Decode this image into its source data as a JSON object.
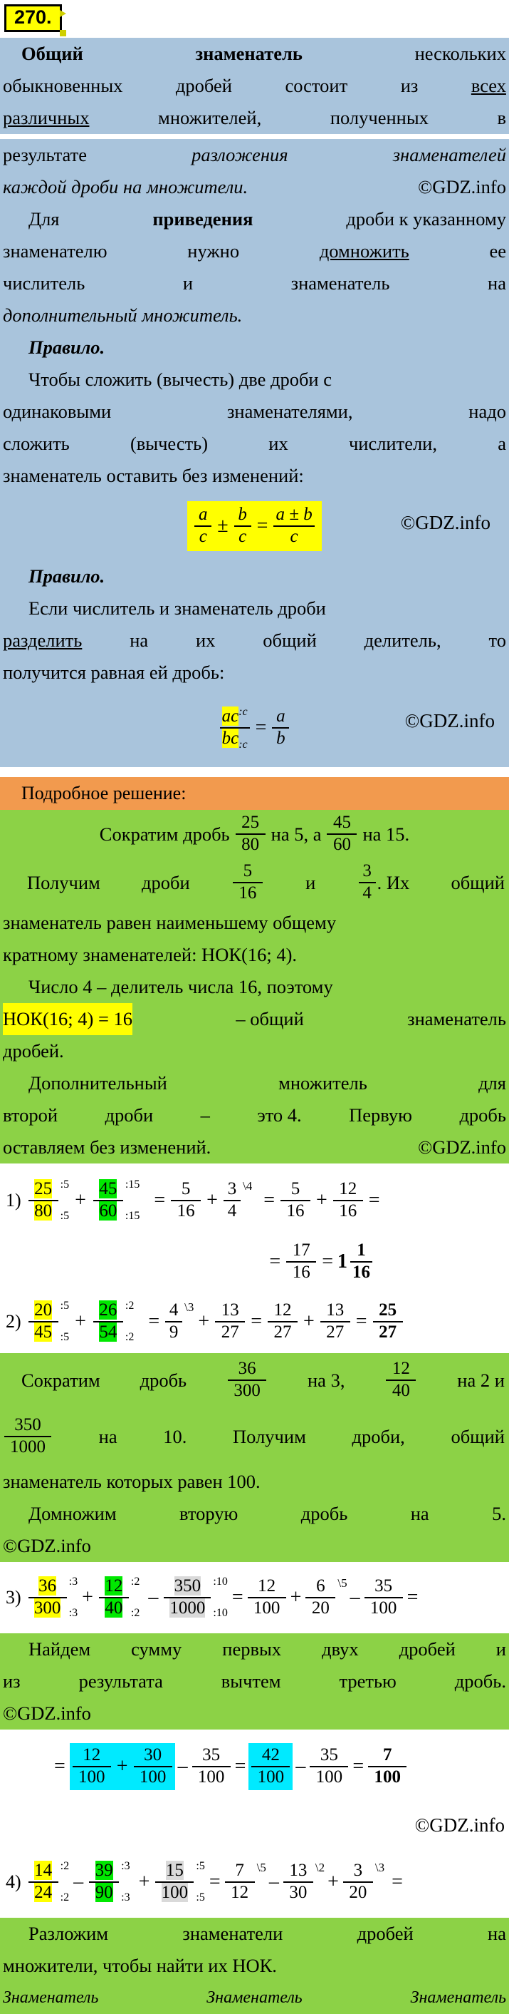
{
  "exercise": {
    "number": "270."
  },
  "watermark": {
    "small": "GDZ.INFO",
    "big": "GDZ.INFO",
    "copyright": "©GDZ.info"
  },
  "colors": {
    "theory_band": "#a9c4dc",
    "solution_band": "#8cd246",
    "header_band": "#f29a4e",
    "highlight_yellow": "#ffff00",
    "highlight_green": "#00e800",
    "highlight_cyan": "#00eaff",
    "highlight_gray": "#d9d9d9",
    "tag_yellow": "#ffff00"
  },
  "theory": {
    "p1": {
      "l1a": "Общий",
      "l1b": "знаменатель",
      "l1c": "нескольких",
      "l2a": "обыкновенных",
      "l2b": "дробей",
      "l2c": "состоит",
      "l2d": "из",
      "l2e": "всех",
      "l3a": "различных",
      "l3b": "множителей,",
      "l3c": "полученных",
      "l3d": "в",
      "l4a": "результате",
      "l4b": "разложения",
      "l4c": "знаменателей",
      "l5a": "каждой дроби на множители.",
      "l5b": "©GDZ.info"
    },
    "p2": {
      "l1a": "Для",
      "l1b": "приведения",
      "l1c": "дроби к указанному",
      "l2a": "знаменателю",
      "l2b": "нужно",
      "l2c": "домножить",
      "l2d": "ее",
      "l3a": "числитель",
      "l3b": "и",
      "l3c": "знаменатель",
      "l3d": "на",
      "l4": "дополнительный множитель."
    },
    "rule1": {
      "title": "Правило.",
      "l1a": "Чтобы сложить (вычесть) две дроби с",
      "l2a": "одинаковыми",
      "l2b": "знаменателями,",
      "l2c": "надо",
      "l3a": "сложить",
      "l3b": "(вычесть)",
      "l3c": "их",
      "l3d": "числители,",
      "l3e": "а",
      "l4": "знаменатель оставить без изменений:",
      "formula": {
        "n1": "a",
        "d1": "c",
        "op1": "±",
        "n2": "b",
        "d2": "c",
        "eq": "=",
        "n3": "a ± b",
        "d3": "c"
      },
      "gdz": "©GDZ.info"
    },
    "rule2": {
      "title": "Правило.",
      "l1": "Если числитель и знаменатель дроби",
      "l2a": "разделить",
      "l2b": "на",
      "l2c": "их",
      "l2d": "общий",
      "l2e": "делитель,",
      "l2f": "то",
      "l3": "получится равная ей дробь:",
      "formula": {
        "n1": "ac",
        "nsup": ":c",
        "d1": "bc",
        "dsub": ":c",
        "eq": "=",
        "n2": "a",
        "d2": "b"
      },
      "gdz": "©GDZ.info"
    }
  },
  "solution_header": "Подробное решение:",
  "step1": {
    "l1a": "Сократим дробь",
    "f1n": "25",
    "f1d": "80",
    "l1b": "на 5, а",
    "f2n": "45",
    "f2d": "60",
    "l1c": "на 15.",
    "l2a": "Получим",
    "l2b": "дроби",
    "f3n": "5",
    "f3d": "16",
    "l2c": "и",
    "f4n": "3",
    "f4d": "4",
    "l2d": ". Их",
    "l2e": "общий",
    "l3": "знаменатель равен наименьшему общему",
    "l4": "кратному знаменателей: НОК(16; 4).",
    "l5": "Число 4 – делитель числа 16, поэтому",
    "l6a": "НОК(16; 4) = 16",
    "l6b": "– общий",
    "l6c": "знаменатель",
    "l7": "дробей.",
    "l8a": "Дополнительный",
    "l8b": "множитель",
    "l8c": "для",
    "l9a": "второй",
    "l9b": "дроби",
    "l9c": "–",
    "l9d": "это 4.",
    "l9e": "Первую",
    "l9f": "дробь",
    "l10a": "оставляем без изменений.",
    "l10b": "©GDZ.info"
  },
  "eq1": {
    "index": "1)",
    "t1": {
      "n": "25",
      "d": "80",
      "nann": ":5",
      "dann": ":5",
      "hl": "yellow"
    },
    "op1": "+",
    "t2": {
      "n": "45",
      "d": "60",
      "nann": ":15",
      "dann": ":15",
      "hl": "green"
    },
    "eq1": "=",
    "t3": {
      "n": "5",
      "d": "16"
    },
    "op2": "+",
    "t4": {
      "n": "3",
      "d": "4",
      "nsup": "\\4"
    },
    "eq2": "=",
    "t5": {
      "n": "5",
      "d": "16"
    },
    "op3": "+",
    "t6": {
      "n": "12",
      "d": "16"
    },
    "eq3": "=",
    "line2_eq": "=",
    "t7": {
      "n": "17",
      "d": "16"
    },
    "eq4": "=",
    "mixed": {
      "whole": "1",
      "n": "1",
      "d": "16"
    }
  },
  "eq2": {
    "index": "2)",
    "t1": {
      "n": "20",
      "d": "45",
      "nann": ":5",
      "dann": ":5",
      "hl": "yellow"
    },
    "op1": "+",
    "t2": {
      "n": "26",
      "d": "54",
      "nann": ":2",
      "dann": ":2",
      "hl": "green"
    },
    "eq1": "=",
    "t3": {
      "n": "4",
      "d": "9",
      "nsup": "\\3"
    },
    "op2": "+",
    "t4": {
      "n": "13",
      "d": "27"
    },
    "eq2": "=",
    "t5": {
      "n": "12",
      "d": "27"
    },
    "op3": "+",
    "t6": {
      "n": "13",
      "d": "27"
    },
    "eq3": "=",
    "t7": {
      "n": "25",
      "d": "27",
      "bold": true
    }
  },
  "step2": {
    "l1a": "Сократим",
    "l1b": "дробь",
    "f1n": "36",
    "f1d": "300",
    "l1c": "на 3,",
    "f2n": "12",
    "f2d": "40",
    "l1d": "на 2 и",
    "f3n": "350",
    "f3d": "1000",
    "l2a": "на",
    "l2b": "10.",
    "l2c": "Получим",
    "l2d": "дроби,",
    "l2e": "общий",
    "l3": "знаменатель которых равен 100.",
    "l4a": "Домножим",
    "l4b": "вторую",
    "l4c": "дробь",
    "l4d": "на",
    "l4e": "5.",
    "l5": "©GDZ.info"
  },
  "eq3": {
    "index": "3)",
    "t1": {
      "n": "36",
      "d": "300",
      "nann": ":3",
      "dann": ":3",
      "hl": "yellow"
    },
    "op1": "+",
    "t2": {
      "n": "12",
      "d": "40",
      "nann": ":2",
      "dann": ":2",
      "hl": "green"
    },
    "op2": "–",
    "t3": {
      "n": "350",
      "d": "1000",
      "nann": ":10",
      "dann": ":10",
      "hl": "gray"
    },
    "eq1": "=",
    "t4": {
      "n": "12",
      "d": "100"
    },
    "op3": "+",
    "t5": {
      "n": "6",
      "d": "20",
      "nsup": "\\5"
    },
    "op4": "–",
    "t6": {
      "n": "35",
      "d": "100"
    },
    "eq2": "="
  },
  "step3": {
    "l1a": "Найдем",
    "l1b": "сумму",
    "l1c": "первых",
    "l1d": "двух",
    "l1e": "дробей",
    "l1f": "и",
    "l2a": "из",
    "l2b": "результата",
    "l2c": "вычтем",
    "l2d": "третью",
    "l2e": "дробь.",
    "l3": "©GDZ.info"
  },
  "eq3b": {
    "eq0": "=",
    "t1": {
      "n": "12",
      "d": "100",
      "hl": "cyan"
    },
    "op1": "+",
    "t2": {
      "n": "30",
      "d": "100",
      "hl": "cyan"
    },
    "op2": "–",
    "t3": {
      "n": "35",
      "d": "100"
    },
    "eq1": "=",
    "t4": {
      "n": "42",
      "d": "100",
      "hl": "cyan"
    },
    "op3": "–",
    "t5": {
      "n": "35",
      "d": "100"
    },
    "eq2": "=",
    "t6": {
      "n": "7",
      "d": "100",
      "bold": true
    },
    "gdz": "©GDZ.info"
  },
  "eq4": {
    "index": "4)",
    "t1": {
      "n": "14",
      "d": "24",
      "nann": ":2",
      "dann": ":2",
      "hl": "yellow"
    },
    "op1": "–",
    "t2": {
      "n": "39",
      "d": "90",
      "nann": ":3",
      "dann": ":3",
      "hl": "green"
    },
    "op2": "+",
    "t3": {
      "n": "15",
      "d": "100",
      "nann": ":5",
      "dann": ":5",
      "hl": "gray"
    },
    "eq1": "=",
    "t4": {
      "n": "7",
      "d": "12",
      "nsup": "\\5"
    },
    "op3": "–",
    "t5": {
      "n": "13",
      "d": "30",
      "nsup": "\\2"
    },
    "op4": "+",
    "t6": {
      "n": "3",
      "d": "20",
      "nsup": "\\3"
    },
    "eq2": "="
  },
  "step4": {
    "l1a": "Разложим",
    "l1b": "знаменатели",
    "l1c": "дробей",
    "l1d": "на",
    "l2": "множители, чтобы найти их НОК.",
    "l3a": "Знаменатель",
    "l3b": "Знаменатель",
    "l3c": "Знаменатель"
  }
}
